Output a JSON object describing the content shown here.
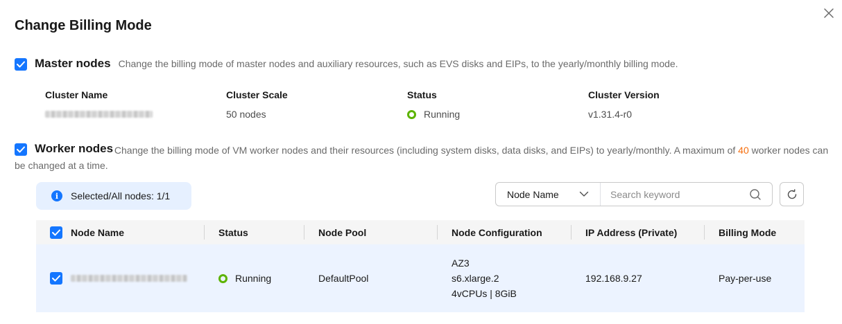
{
  "dialog": {
    "title": "Change Billing Mode"
  },
  "master": {
    "title": "Master nodes",
    "description": "Change the billing mode of master nodes and auxiliary resources, such as EVS disks and EIPs, to the yearly/monthly billing mode.",
    "checked": true,
    "columns": [
      "Cluster Name",
      "Cluster Scale",
      "Status",
      "Cluster Version"
    ],
    "cluster_scale": "50 nodes",
    "status": "Running",
    "cluster_version": "v1.31.4-r0"
  },
  "worker": {
    "title": "Worker nodes",
    "description_before": "Change the billing mode of VM worker nodes and their resources (including system disks, data disks, and EIPs) to yearly/monthly. A maximum of ",
    "max_count": "40",
    "description_after": " worker nodes can be changed at a time.",
    "checked": true
  },
  "selection": {
    "badge_text": "Selected/All nodes: 1/1"
  },
  "search": {
    "filter_selected": "Node Name",
    "placeholder": "Search keyword"
  },
  "table": {
    "headers": {
      "node_name": "Node Name",
      "status": "Status",
      "node_pool": "Node Pool",
      "node_config": "Node Configuration",
      "ip": "IP Address (Private)",
      "billing": "Billing Mode"
    },
    "rows": [
      {
        "status": "Running",
        "node_pool": "DefaultPool",
        "config_az": "AZ3",
        "config_flavor": "s6.xlarge.2",
        "config_spec": "4vCPUs | 8GiB",
        "ip": "192.168.9.27",
        "billing": "Pay-per-use"
      }
    ]
  },
  "colors": {
    "primary": "#1476ff",
    "running": "#5cb300",
    "accent": "#f66f0f",
    "row_selected": "#ecf3ff"
  },
  "icons": [
    "close-icon",
    "check-icon",
    "info-icon",
    "chevron-down-icon",
    "search-icon",
    "refresh-icon"
  ]
}
